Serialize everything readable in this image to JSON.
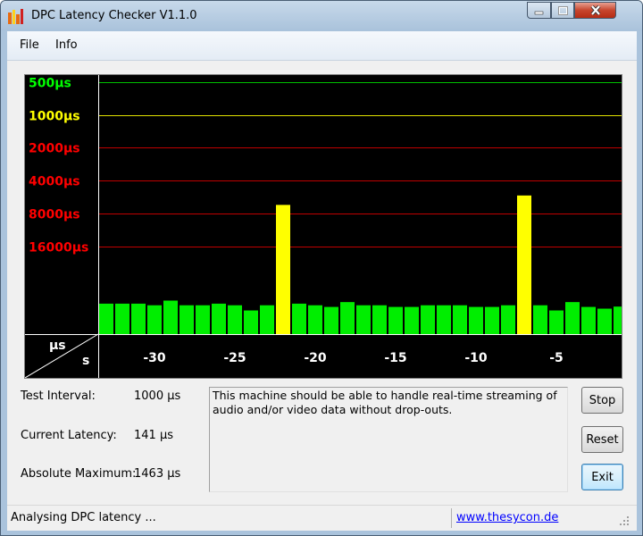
{
  "window": {
    "title": "DPC Latency Checker V1.1.0"
  },
  "menu": {
    "items": [
      "File",
      "Info"
    ]
  },
  "graph": {
    "y_ticks": [
      {
        "label": "16000µs",
        "color": "#ff0000"
      },
      {
        "label": "8000µs",
        "color": "#ff0000"
      },
      {
        "label": "4000µs",
        "color": "#ff0000"
      },
      {
        "label": "2000µs",
        "color": "#ff0000"
      },
      {
        "label": "1000µs",
        "color": "#ffff00"
      },
      {
        "label": "500µs",
        "color": "#00ff00"
      }
    ],
    "corner_top": "µs",
    "corner_bottom": "s",
    "x_ticks": [
      "-30",
      "-25",
      "-20",
      "-15",
      "-10",
      "-5"
    ]
  },
  "chart_data": {
    "type": "bar",
    "xlabel": "s",
    "ylabel": "µs",
    "y_scale": "log2",
    "y_ticks": [
      500,
      1000,
      2000,
      4000,
      8000,
      16000
    ],
    "x_ticks": [
      -30,
      -25,
      -20,
      -15,
      -10,
      -5
    ],
    "x": [
      -33,
      -32,
      -31,
      -30,
      -29,
      -28,
      -27,
      -26,
      -25,
      -24,
      -23,
      -22,
      -21,
      -20,
      -19,
      -18,
      -17,
      -16,
      -15,
      -14,
      -13,
      -12,
      -11,
      -10,
      -9,
      -8,
      -7,
      -6,
      -5,
      -4,
      -3,
      -2,
      -1
    ],
    "values": [
      150,
      150,
      150,
      145,
      160,
      145,
      145,
      150,
      145,
      130,
      145,
      1200,
      150,
      145,
      140,
      155,
      145,
      145,
      140,
      140,
      145,
      145,
      145,
      140,
      140,
      145,
      1463,
      145,
      130,
      155,
      140,
      135,
      141
    ],
    "bar_colors": {
      "normal": "#00ee00",
      "warning": "#ffff00"
    }
  },
  "stats": {
    "test_interval_label": "Test Interval:",
    "test_interval_value": "1000 µs",
    "current_latency_label": "Current Latency:",
    "current_latency_value": "141 µs",
    "absolute_maximum_label": "Absolute Maximum:",
    "absolute_maximum_value": "1463 µs"
  },
  "message": "This machine should be able to handle real-time streaming of audio and/or video data without drop-outs.",
  "buttons": {
    "stop": "Stop",
    "reset": "Reset",
    "exit": "Exit"
  },
  "status": {
    "text": "Analysing DPC latency ...",
    "link": "www.thesycon.de"
  }
}
